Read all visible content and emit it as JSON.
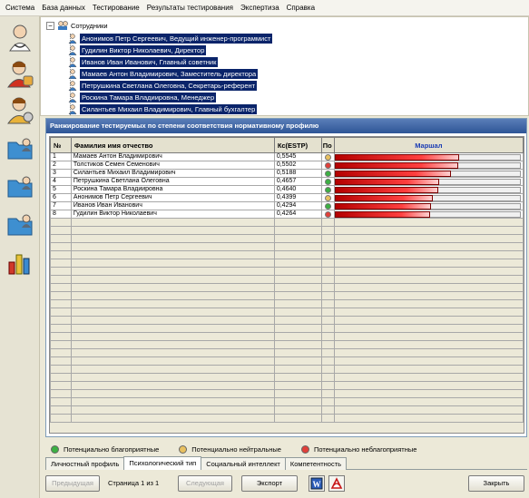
{
  "menu": [
    "Система",
    "База данных",
    "Тестирование",
    "Результаты тестирования",
    "Экспертиза",
    "Справка"
  ],
  "toolbar": {
    "buttons": [
      {
        "icon": "doctor-person-icon"
      },
      {
        "icon": "user-add-icon"
      },
      {
        "icon": "user-settings-icon"
      },
      {
        "icon": "folder-person-icon"
      },
      {
        "icon": "folder-person-2-icon"
      },
      {
        "icon": "folder-person-3-icon"
      },
      {
        "icon": "bar-chart-icon"
      }
    ]
  },
  "tree": {
    "root": "Сотрудники",
    "expander": "−",
    "employees": [
      "Анонимов Петр Сергеевич, Ведущий инженер-программист",
      "Гудилин Виктор Николаевич, Директор",
      "Иванов Иван Иванович, Главный советник",
      "Мамаев Антон Владимирович, Заместитель директора",
      "Петрушкина Светлана Олеговна, Секретарь-референт",
      "Роскина Тамара Владиировна, Менеджер",
      "Силантьев Михаил Владимирович, Главный бухгалтер"
    ]
  },
  "panel": {
    "title": "Ранжирование тестируемых по степени соответствия нормативному профилю",
    "columns": {
      "num": "№",
      "name": "Фамилия имя отчество",
      "score": "Кс(ESTP)",
      "status": "По",
      "chart": "Маршал"
    },
    "rows": [
      {
        "num": "1",
        "name": "Мамаев Антон Владимирович",
        "score": "0,5545",
        "status": "neutral",
        "value": 0.5545
      },
      {
        "num": "2",
        "name": "Толстиков Семен Семенович",
        "score": "0,5502",
        "status": "unfavorable",
        "value": 0.5502
      },
      {
        "num": "3",
        "name": "Силантьев Михаил Владимирович",
        "score": "0,5188",
        "status": "favorable",
        "value": 0.5188
      },
      {
        "num": "4",
        "name": "Петрушкина Светлана Олеговна",
        "score": "0,4657",
        "status": "favorable",
        "value": 0.4657
      },
      {
        "num": "5",
        "name": "Роскина Тамара Владиировна",
        "score": "0,4640",
        "status": "favorable",
        "value": 0.464
      },
      {
        "num": "6",
        "name": "Анонимов Петр Сергеевич",
        "score": "0,4399",
        "status": "neutral",
        "value": 0.4399
      },
      {
        "num": "7",
        "name": "Иванов Иван Иванович",
        "score": "0,4294",
        "status": "favorable",
        "value": 0.4294
      },
      {
        "num": "8",
        "name": "Гудилин Виктор Николаевич",
        "score": "0,4264",
        "status": "unfavorable",
        "value": 0.4264
      }
    ],
    "empty_rows": 25
  },
  "status_colors": {
    "favorable": "#3cb043",
    "neutral": "#e8c060",
    "unfavorable": "#e0403a"
  },
  "legend": {
    "favorable": "Потенциально благоприятные",
    "neutral": "Потенциально нейтральные",
    "unfavorable": "Потенциально неблагоприятные"
  },
  "tabs": {
    "items": [
      "Личностный профиль",
      "Психологический тип",
      "Социальный интеллект",
      "Компетентность"
    ],
    "active_index": 1
  },
  "bottom": {
    "prev_label": "Предыдущая",
    "page_info": "Страница 1 из 1",
    "next_label": "Следующая",
    "export_label": "Экспорт",
    "word_icon": "word-icon",
    "pdf_icon": "pdf-icon",
    "close_label": "Закрыть"
  }
}
